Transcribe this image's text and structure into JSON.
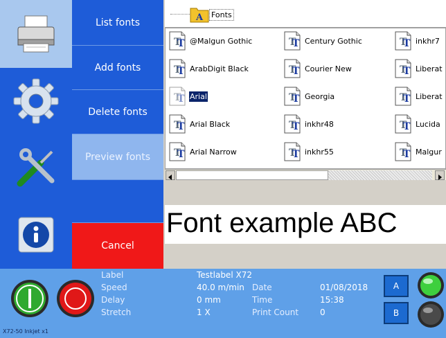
{
  "menu": {
    "list_fonts": "List fonts",
    "add_fonts": "Add fonts",
    "delete_fonts": "Delete fonts",
    "preview_fonts": "Preview fonts",
    "cancel": "Cancel"
  },
  "sidebar": {
    "icons": [
      "printer-icon",
      "settings-gear-icon",
      "tools-icon",
      "info-icon"
    ],
    "active": "printer-icon"
  },
  "browser": {
    "path_label": "Fonts",
    "items": [
      {
        "name": "@Malgun Gothic",
        "selected": false
      },
      {
        "name": "ArabDigit Black",
        "selected": false
      },
      {
        "name": "Arial",
        "selected": true
      },
      {
        "name": "Arial Black",
        "selected": false
      },
      {
        "name": "Arial Narrow",
        "selected": false
      },
      {
        "name": "Century Gothic",
        "selected": false
      },
      {
        "name": "Courier New",
        "selected": false
      },
      {
        "name": "Georgia",
        "selected": false
      },
      {
        "name": "inkhr48",
        "selected": false
      },
      {
        "name": "inkhr55",
        "selected": false
      },
      {
        "name": "inkhr7",
        "selected": false
      },
      {
        "name": "Liberat",
        "selected": false
      },
      {
        "name": "Liberat",
        "selected": false
      },
      {
        "name": "Lucida",
        "selected": false
      },
      {
        "name": "Malgur",
        "selected": false
      }
    ]
  },
  "preview": {
    "text": "Font example ABC"
  },
  "status": {
    "label_key": "Label",
    "label_value": "Testlabel X72",
    "speed_key": "Speed",
    "speed_value": "40.0 m/min",
    "delay_key": "Delay",
    "delay_value": "0 mm",
    "stretch_key": "Stretch",
    "stretch_value": "1 X",
    "date_key": "Date",
    "date_value": "01/08/2018",
    "time_key": "Time",
    "time_value": "15:38",
    "count_key": "Print Count",
    "count_value": "0",
    "head_a": "A",
    "head_b": "B",
    "device": "X72-50 Inkjet x1"
  },
  "colors": {
    "menu_blue": "#1e5cd8",
    "cancel_red": "#f01818",
    "status_bg": "#5fa0e8",
    "selection": "#0a246a"
  }
}
